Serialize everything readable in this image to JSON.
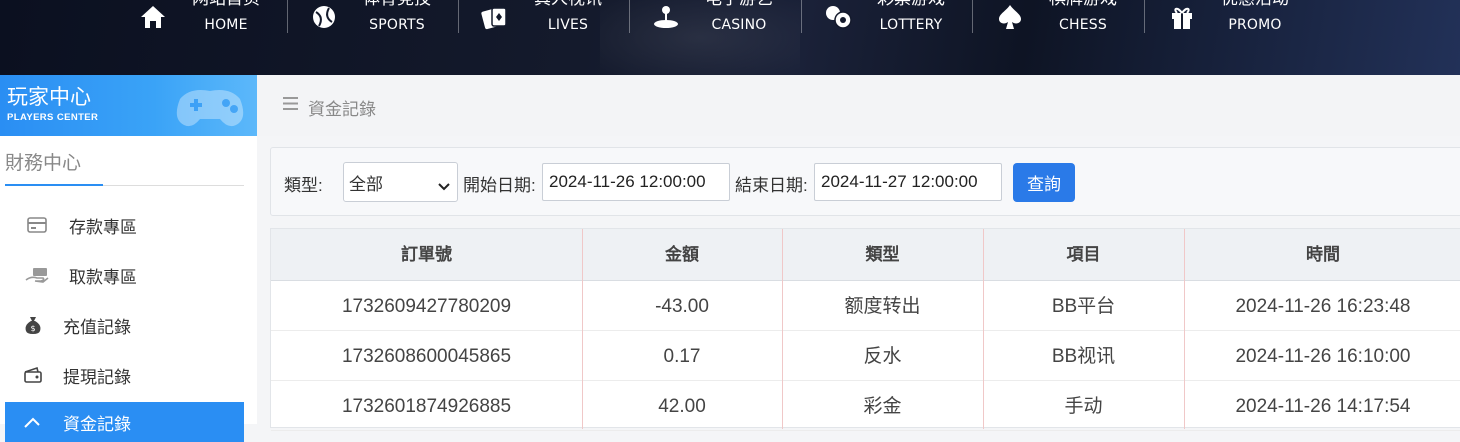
{
  "topnav": {
    "items": [
      {
        "cn": "网站首页",
        "en": "HOME",
        "icon": "home-icon"
      },
      {
        "cn": "体育竞技",
        "en": "SPORTS",
        "icon": "ball-icon"
      },
      {
        "cn": "真人视讯",
        "en": "LIVES",
        "icon": "cards-icon"
      },
      {
        "cn": "电子游艺",
        "en": "CASINO",
        "icon": "joystick-icon"
      },
      {
        "cn": "彩票游戏",
        "en": "LOTTERY",
        "icon": "lottery-balls-icon"
      },
      {
        "cn": "棋牌游戏",
        "en": "CHESS",
        "icon": "spade-icon"
      },
      {
        "cn": "优惠活动",
        "en": "PROMO",
        "icon": "gift-icon"
      }
    ]
  },
  "sidebar": {
    "title": "玩家中心",
    "subtitle": "PLAYERS CENTER",
    "section": "財務中心",
    "items": [
      {
        "label": "存款專區",
        "icon": "deposit-card-icon"
      },
      {
        "label": "取款專區",
        "icon": "withdraw-hand-icon"
      },
      {
        "label": "充值記錄",
        "icon": "money-bag-icon"
      },
      {
        "label": "提現記錄",
        "icon": "wallet-icon"
      },
      {
        "label": "資金記錄",
        "icon": "record-icon"
      }
    ]
  },
  "breadcrumb": {
    "text": "資金記錄"
  },
  "filter": {
    "type_label": "類型:",
    "type_value": "全部",
    "start_label": "開始日期:",
    "start_value": "2024-11-26 12:00:00",
    "end_label": "結束日期:",
    "end_value": "2024-11-27 12:00:00",
    "query_button": "查詢"
  },
  "table": {
    "headers": [
      "訂單號",
      "金額",
      "類型",
      "項目",
      "時間"
    ],
    "rows": [
      [
        "1732609427780209",
        "-43.00",
        "额度转出",
        "BB平台",
        "2024-11-26 16:23:48"
      ],
      [
        "1732608600045865",
        "0.17",
        "反水",
        "BB视讯",
        "2024-11-26 16:10:00"
      ],
      [
        "1732601874926885",
        "42.00",
        "彩金",
        "手动",
        "2024-11-26 14:17:54"
      ]
    ]
  },
  "colors": {
    "accent": "#2a8ef3",
    "button": "#2a7ae8"
  }
}
